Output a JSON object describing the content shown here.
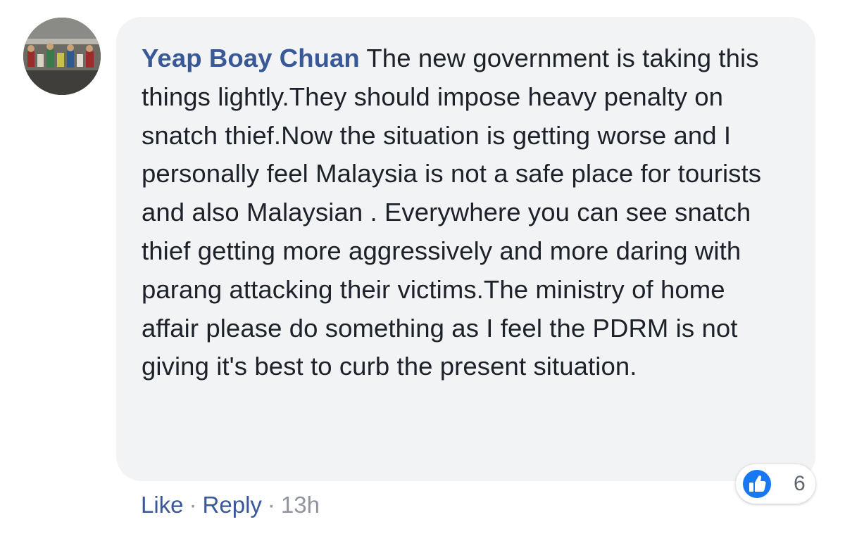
{
  "comment": {
    "author": "Yeap Boay Chuan",
    "text": "The new government is taking this things lightly.They should impose heavy penalty on snatch thief.Now the situation is getting worse and I personally feel Malaysia is not a safe place for tourists and also Malaysian . Everywhere you can see snatch thief getting more aggressively and more daring with parang attacking their victims.The ministry of home affair please do something as I feel the PDRM is not giving it's best to curb the present situation.",
    "avatar_icon": "profile-photo",
    "reactions": {
      "icon": "thumbs-up-icon",
      "count": "6",
      "color": "#1877f2"
    }
  },
  "actions": {
    "like_label": "Like",
    "reply_label": "Reply",
    "separator": "·",
    "timestamp": "13h"
  },
  "colors": {
    "author_link": "#385898",
    "bubble_bg": "#f2f3f5",
    "meta_text": "#90949c"
  }
}
